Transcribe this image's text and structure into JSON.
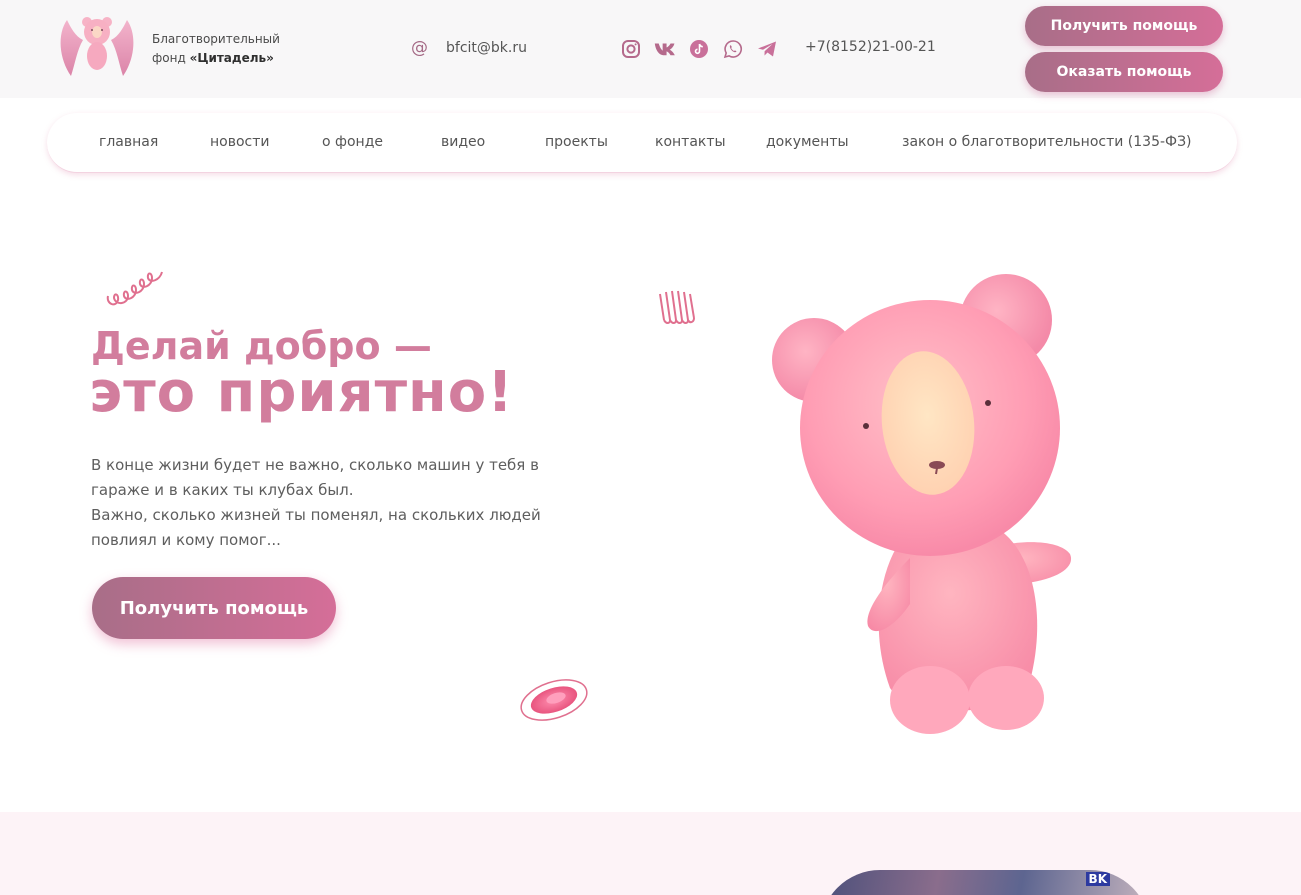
{
  "header": {
    "brand_line1": "Благотворительный",
    "brand_line2_prefix": "фонд ",
    "brand_line2_name": "«Цитадель»",
    "email_icon": "@",
    "email": "bfcit@bk.ru",
    "socials": [
      "instagram-icon",
      "vk-icon",
      "tiktok-icon",
      "whatsapp-icon",
      "telegram-icon"
    ],
    "phone": "+7(8152)21-00-21",
    "get_help_label": "Получить помощь",
    "give_help_label": "Оказать помощь"
  },
  "nav": {
    "items": [
      {
        "label": "главная"
      },
      {
        "label": "новости"
      },
      {
        "label": "о фонде"
      },
      {
        "label": "видео"
      },
      {
        "label": "проекты"
      },
      {
        "label": "контакты"
      },
      {
        "label": "документы"
      },
      {
        "label": "закон о благотворительности (135-ФЗ)"
      }
    ]
  },
  "hero": {
    "title_line1": "Делай добро —",
    "title_line2": "это приятно!",
    "text_line1": "В конце жизни будет не важно, сколько машин у тебя в гараже и в каких ты клубах был.",
    "text_line2": "Важно, сколько жизней ты поменял, на скольких людей повлиял и кому помог...",
    "cta_label": "Получить помощь"
  },
  "colors": {
    "accent": "#d27d9d",
    "button_start": "#a86e88",
    "button_end": "#d56e98",
    "header_bg": "#f8f7f8",
    "section_bg": "#fdf3f7"
  }
}
